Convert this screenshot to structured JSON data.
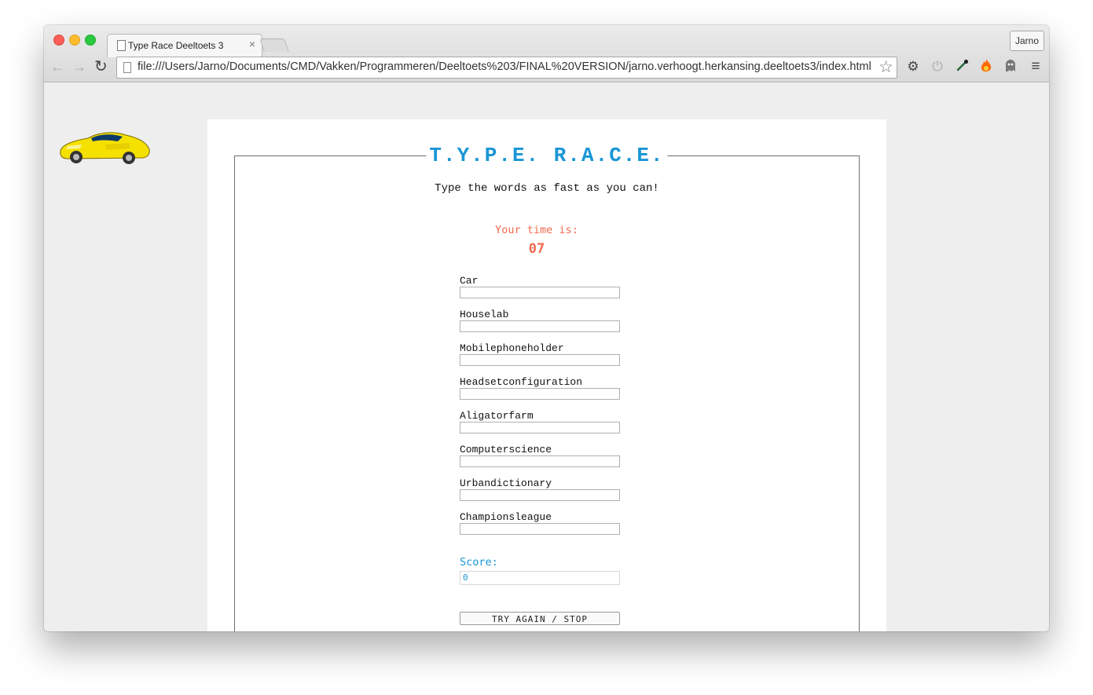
{
  "browser": {
    "tab_title": "Type Race Deeltoets 3",
    "tab_close": "×",
    "profile_name": "Jarno",
    "url": "file:///Users/Jarno/Documents/CMD/Vakken/Programmeren/Deeltoets%203/FINAL%20VERSION/jarno.verhoogt.herkansing.deeltoets3/index.html",
    "nav": {
      "back": "←",
      "forward": "→",
      "reload": "↻"
    },
    "icons": [
      "page-icon",
      "star-icon",
      "gear-icon",
      "power-icon",
      "eyedropper-icon",
      "fire-icon",
      "ghost-icon",
      "menu-icon"
    ]
  },
  "page": {
    "title": "T.Y.P.E. R.A.C.E.",
    "subtitle": "Type the words as fast as you can!",
    "time_label": "Your time is:",
    "time_value": "07",
    "words": [
      "Car",
      "Houselab",
      "Mobilephoneholder",
      "Headsetconfiguration",
      "Aligatorfarm",
      "Computerscience",
      "Urbandictionary",
      "Championsleague"
    ],
    "score_label": "Score:",
    "score_value": "0",
    "button_label": "TRY AGAIN / STOP"
  },
  "colors": {
    "accent_blue": "#1996d5",
    "time_red": "#f26a4f",
    "car_yellow": "#f5e100"
  }
}
